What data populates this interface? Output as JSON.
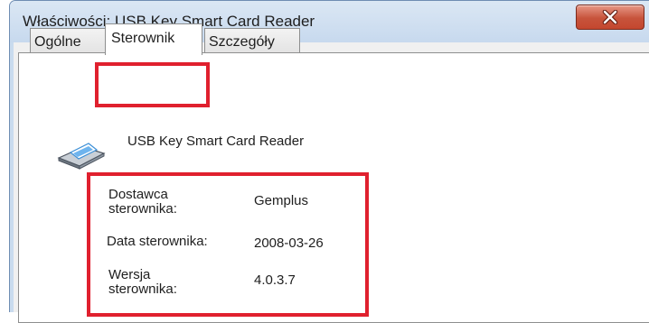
{
  "window": {
    "title": "Właściwości: USB Key Smart Card Reader",
    "close_glyph": "X"
  },
  "tabs": [
    {
      "label": "Ogólne",
      "active": false
    },
    {
      "label": "Sterownik",
      "active": true
    },
    {
      "label": "Szczegóły",
      "active": false
    }
  ],
  "device": {
    "icon": "smart-card-reader-icon",
    "name": "USB Key Smart Card Reader"
  },
  "driver_info": {
    "provider_label": "Dostawca sterownika:",
    "provider_label_line1": "Dostawca",
    "provider_label_line2": "sterownika:",
    "provider_value": "Gemplus",
    "date_label": "Data sterownika:",
    "date_value": "2008-03-26",
    "version_label": "Wersja sterownika:",
    "version_label_line1": "Wersja",
    "version_label_line2": "sterownika:",
    "version_value": "4.0.3.7"
  },
  "colors": {
    "annotation_red": "#e0202e",
    "close_button": "#c4472f",
    "titlebar": "#c9dbee"
  }
}
